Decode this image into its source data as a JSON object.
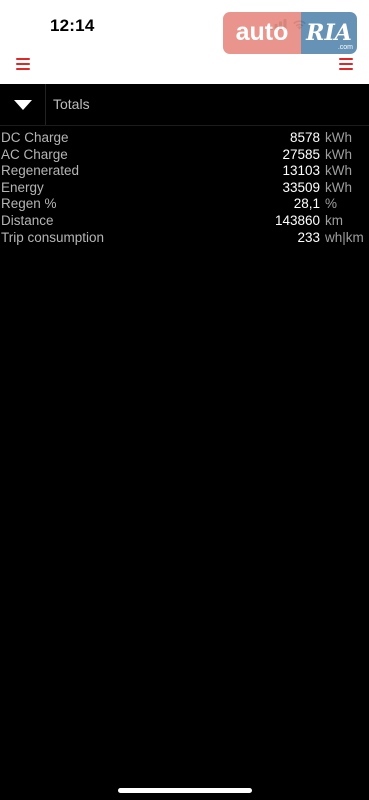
{
  "status_bar": {
    "time": "12:14",
    "signal_icon": "cellular-signal-icon",
    "wifi_icon": "wifi-icon"
  },
  "watermark": {
    "text_left": "auto",
    "text_right": "RIA",
    "text_small": ".com"
  },
  "nav": {
    "left_icon": "hamburger-menu-icon",
    "right_icon": "hamburger-menu-icon",
    "accent_color": "#e02626"
  },
  "section": {
    "toggle_icon": "caret-down-icon",
    "title": "Totals"
  },
  "stats": [
    {
      "label": "DC Charge",
      "value": "8578",
      "unit": "kWh"
    },
    {
      "label": "AC Charge",
      "value": "27585",
      "unit": "kWh"
    },
    {
      "label": "Regenerated",
      "value": "13103",
      "unit": "kWh"
    },
    {
      "label": "Energy",
      "value": "33509",
      "unit": "kWh"
    },
    {
      "label": "Regen %",
      "value": "28,1",
      "unit": "%"
    },
    {
      "label": "Distance",
      "value": "143860",
      "unit": "km"
    },
    {
      "label": "Trip consumption",
      "value": "233",
      "unit": "wh|km"
    }
  ]
}
